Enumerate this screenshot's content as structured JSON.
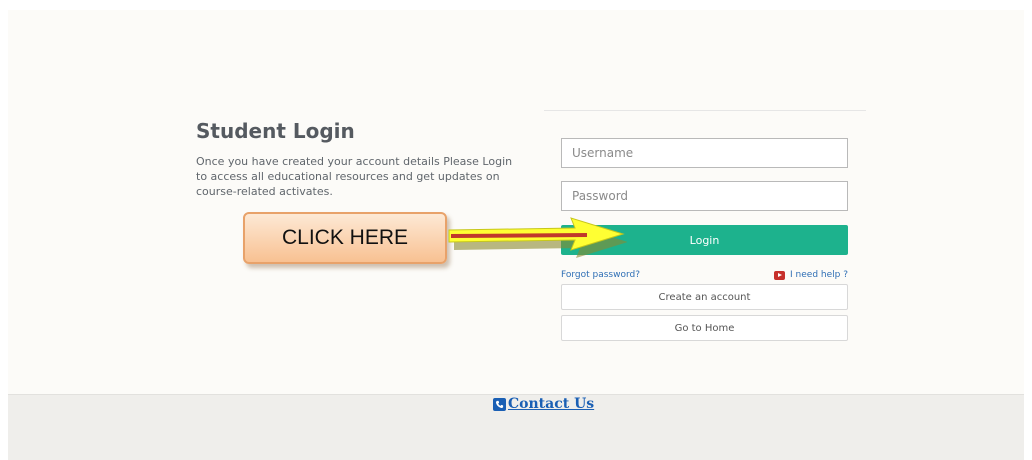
{
  "login": {
    "title": "Student Login",
    "description": "Once you have created your account details Please Login to access all educational resources and get updates on course-related activates.",
    "username_placeholder": "Username",
    "password_placeholder": "Password",
    "login_label": "Login",
    "forgot_label": "Forgot password?",
    "help_label": "I need help ?",
    "create_label": "Create an account",
    "home_label": "Go to Home"
  },
  "annotation": {
    "callout_text": "CLICK HERE"
  },
  "footer": {
    "contact_label": "Contact Us"
  },
  "icons": {
    "contact": "phone-icon",
    "help": "youtube-icon"
  },
  "colors": {
    "login_button": "#1db28d",
    "link": "#2f6fb5",
    "arrow_fill": "#ffff33",
    "arrow_shaft": "#c0392b",
    "callout": "#f8c192"
  }
}
